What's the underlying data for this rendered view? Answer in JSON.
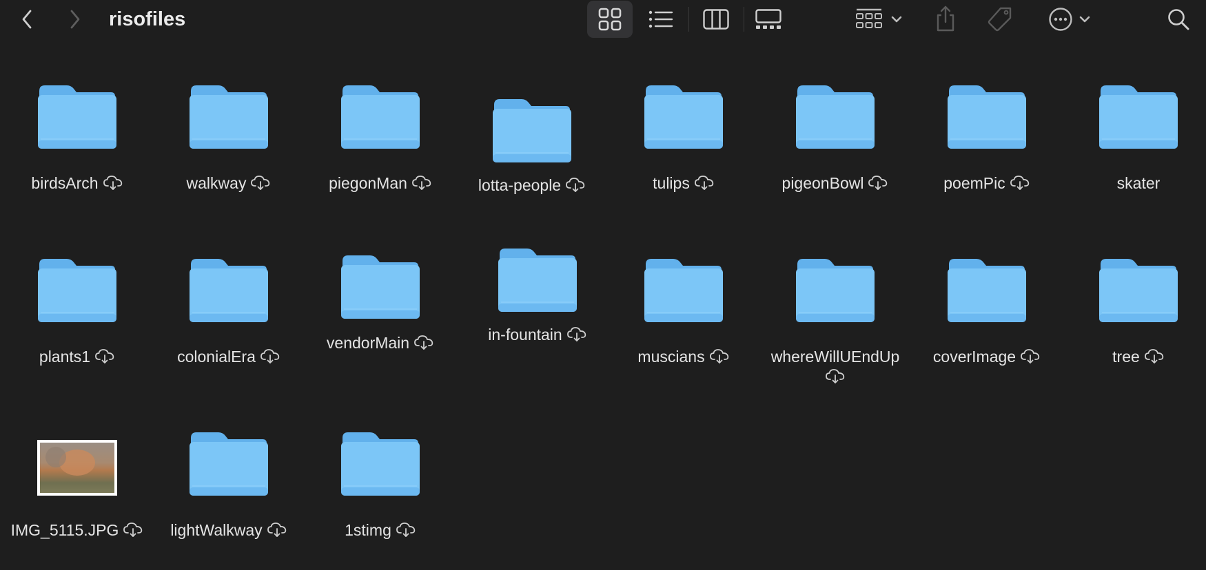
{
  "window": {
    "title": "risofiles"
  },
  "toolbar": {
    "back_icon": "chevron-left-icon",
    "forward_icon": "chevron-right-icon",
    "view_modes": [
      "icon-view",
      "list-view",
      "column-view",
      "gallery-view"
    ],
    "active_view": "icon-view",
    "group_icon": "group-by-icon",
    "share_icon": "share-icon",
    "tag_icon": "tag-icon",
    "more_icon": "ellipsis-circle-icon",
    "search_icon": "search-icon"
  },
  "colors": {
    "background": "#1e1e1e",
    "folder_body": "#7cc6f7",
    "folder_tab": "#62b1ec",
    "text": "#e4e4e4"
  },
  "items": [
    {
      "name": "birdsArch",
      "type": "folder",
      "icloud": true
    },
    {
      "name": "walkway",
      "type": "folder",
      "icloud": true
    },
    {
      "name": "piegonMan",
      "type": "folder",
      "icloud": true
    },
    {
      "name": "lotta-people",
      "type": "folder",
      "icloud": true
    },
    {
      "name": "tulips",
      "type": "folder",
      "icloud": true
    },
    {
      "name": "pigeonBowl",
      "type": "folder",
      "icloud": true
    },
    {
      "name": "poemPic",
      "type": "folder",
      "icloud": true
    },
    {
      "name": "skater",
      "type": "folder",
      "icloud": false
    },
    {
      "name": "plants1",
      "type": "folder",
      "icloud": true
    },
    {
      "name": "colonialEra",
      "type": "folder",
      "icloud": true
    },
    {
      "name": "vendorMain",
      "type": "folder",
      "icloud": true
    },
    {
      "name": "in-fountain",
      "type": "folder",
      "icloud": true
    },
    {
      "name": "muscians",
      "type": "folder",
      "icloud": true
    },
    {
      "name": "whereWillUEndUp",
      "type": "folder",
      "icloud": true
    },
    {
      "name": "coverImage",
      "type": "folder",
      "icloud": true
    },
    {
      "name": "tree",
      "type": "folder",
      "icloud": true
    },
    {
      "name": "IMG_5115.JPG",
      "type": "image",
      "icloud": true
    },
    {
      "name": "lightWalkway",
      "type": "folder",
      "icloud": true
    },
    {
      "name": "1stimg",
      "type": "folder",
      "icloud": true
    }
  ]
}
